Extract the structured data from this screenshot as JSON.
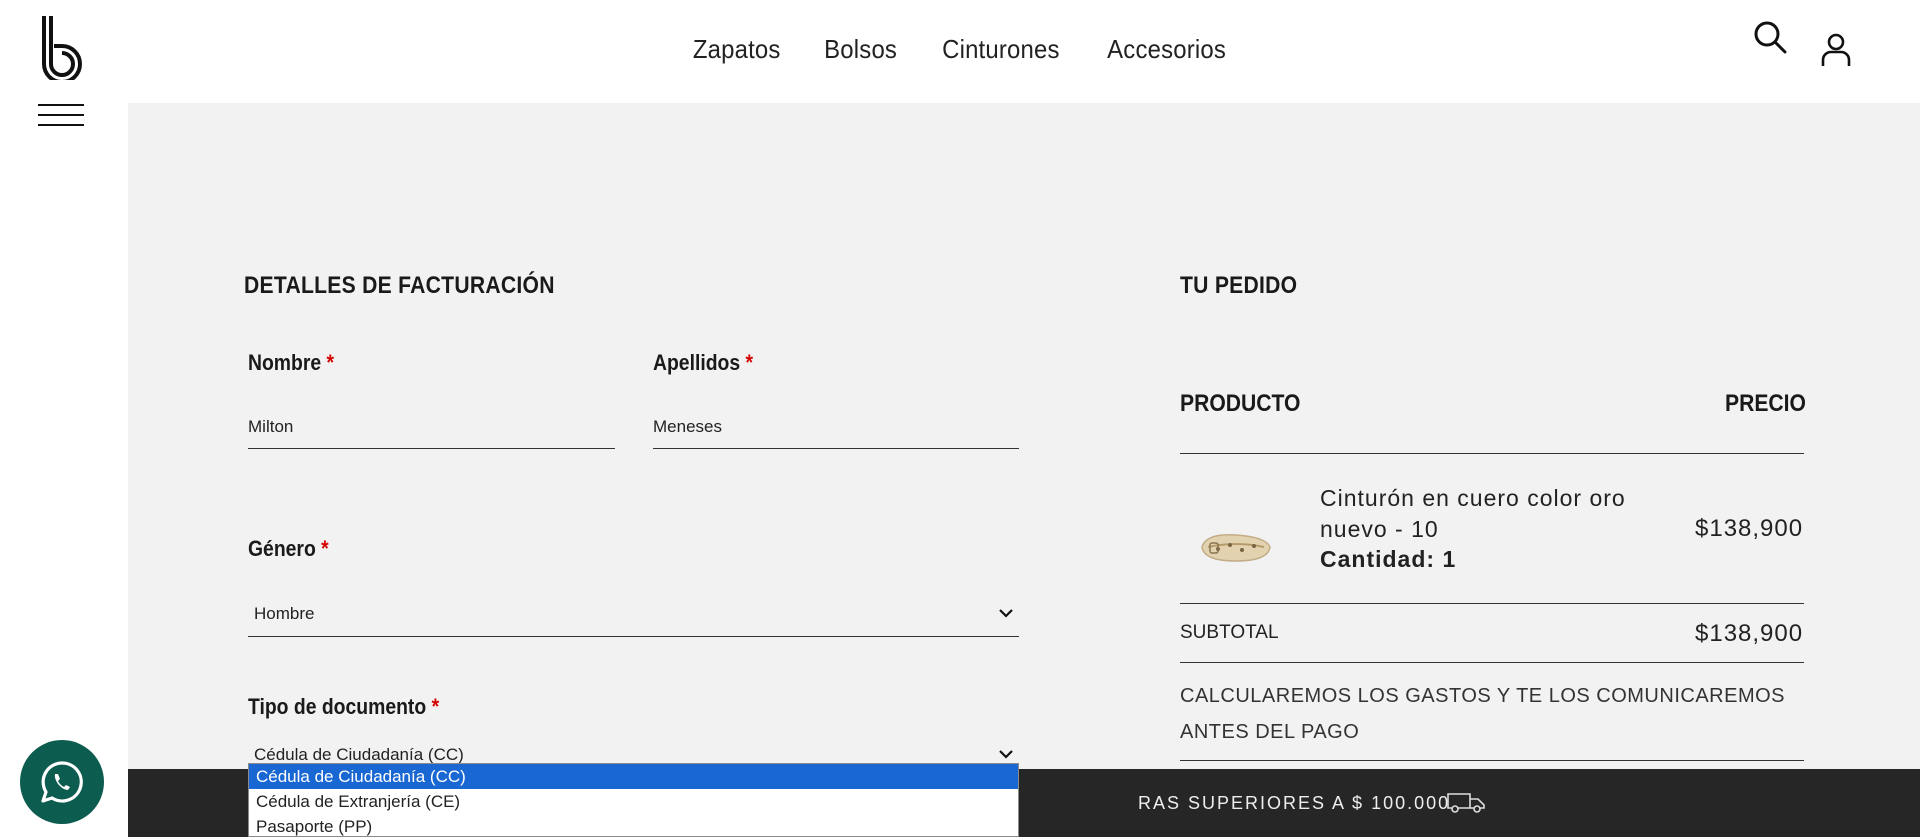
{
  "header": {
    "nav": [
      "Zapatos",
      "Bolsos",
      "Cinturones",
      "Accesorios"
    ]
  },
  "billing": {
    "title": "DETALLES DE FACTURACIÓN",
    "nombre_label": "Nombre",
    "nombre_value": "Milton",
    "apellidos_label": "Apellidos",
    "apellidos_value": "Meneses",
    "genero_label": "Género",
    "genero_value": "Hombre",
    "tipo_doc_label": "Tipo de documento",
    "tipo_doc_value": "Cédula de Ciudadanía (CC)",
    "required_mark": "*",
    "tipo_doc_options": [
      "Cédula de Ciudadanía (CC)",
      "Cédula de Extranjería (CE)",
      "Pasaporte (PP)"
    ]
  },
  "order": {
    "title": "TU PEDIDO",
    "col_product": "PRODUCTO",
    "col_price": "PRECIO",
    "product_name": "Cinturón en cuero color oro nuevo - 10",
    "product_qty": "Cantidad: 1",
    "product_price": "$138,900",
    "subtotal_label": "SUBTOTAL",
    "subtotal_value": "$138,900",
    "shipping_note": "CALCULAREMOS LOS GASTOS Y TE LOS COMUNICAREMOS ANTES DEL PAGO"
  },
  "banner": {
    "text": "RAS SUPERIORES A $ 100.000"
  },
  "colors": {
    "required": "#d50000",
    "whatsapp": "#0d5c50",
    "banner_bg": "#262626",
    "selected_option": "#1967d2",
    "main_bg": "#f2f2f2"
  },
  "icons": [
    "logo-b",
    "hamburger-icon",
    "search-icon",
    "user-icon",
    "chevron-down-icon",
    "truck-icon",
    "whatsapp-icon"
  ]
}
